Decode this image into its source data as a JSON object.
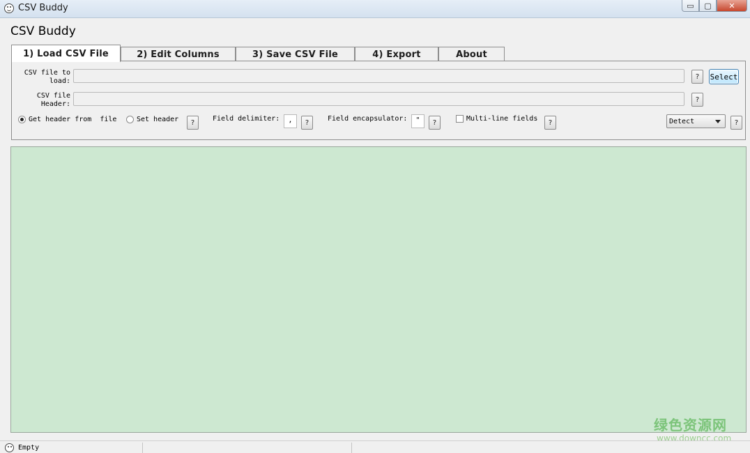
{
  "window": {
    "title": "CSV Buddy",
    "controls": {
      "minimize": "▭",
      "maximize": "▢",
      "close": "✕"
    }
  },
  "app_header": "CSV Buddy",
  "tabs": [
    {
      "label": "1) Load CSV File",
      "active": true
    },
    {
      "label": "2) Edit Columns",
      "active": false
    },
    {
      "label": "3) Save CSV File",
      "active": false
    },
    {
      "label": "4) Export",
      "active": false
    },
    {
      "label": "About",
      "active": false
    }
  ],
  "load_tab": {
    "csv_file_label": "CSV file to\nload:",
    "csv_file_value": "",
    "select_button": "Select",
    "header_label": "CSV file\nHeader:",
    "header_value": "",
    "help": "?",
    "radio_get_header": "Get header from  file",
    "radio_set_header": "Set header",
    "field_delimiter_label": "Field delimiter:",
    "field_delimiter_value": ",",
    "field_encapsulator_label": "Field encapsulator:",
    "field_encapsulator_value": "\"",
    "multiline_label": "Multi-line fields",
    "detect_dropdown": "Detect"
  },
  "watermark": {
    "cn": "绿色资源网",
    "url": "www.downcc.com"
  },
  "status": {
    "text": "Empty"
  }
}
